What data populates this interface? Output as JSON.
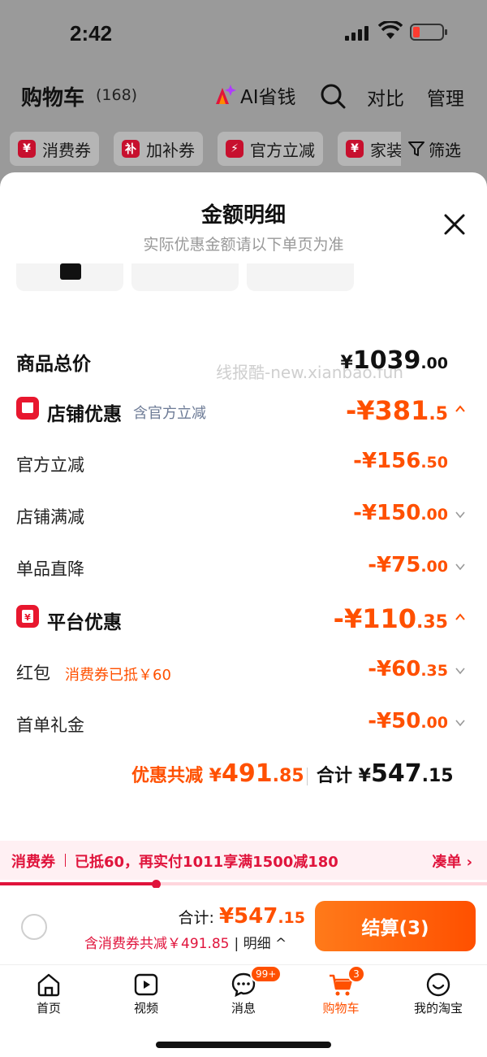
{
  "status": {
    "time": "2:42"
  },
  "header": {
    "title": "购物车",
    "count": "(168)",
    "ai_label": "AI省钱",
    "compare": "对比",
    "manage": "管理"
  },
  "chips": [
    {
      "icon": "¥",
      "label": "消费券"
    },
    {
      "icon": "补",
      "label": "加补券"
    },
    {
      "icon": "⚡",
      "label": "官方立减"
    },
    {
      "icon": "¥",
      "label": "家装"
    }
  ],
  "filter": "筛选",
  "sheet": {
    "title": "金额明细",
    "subtitle": "实际优惠金额请以下单页为准"
  },
  "watermark": "线报酷-new.xianbao.fun",
  "rows": {
    "total": {
      "label": "商品总价",
      "yen": "¥",
      "int": "1039",
      "dec": ".00"
    },
    "shop": {
      "label": "店铺优惠",
      "note": "含官方立减",
      "int": "-¥381",
      "dec": ".5"
    },
    "official": {
      "label": "官方立减",
      "int": "-¥156",
      "dec": ".50"
    },
    "shop_full": {
      "label": "店铺满减",
      "int": "-¥150",
      "dec": ".00"
    },
    "direct": {
      "label": "单品直降",
      "int": "-¥75",
      "dec": ".00"
    },
    "platform": {
      "label": "平台优惠",
      "int": "-¥110",
      "dec": ".35"
    },
    "redpack": {
      "label": "红包",
      "note": "消费券已抵￥60",
      "int": "-¥60",
      "dec": ".35"
    },
    "gift": {
      "label": "首单礼金",
      "int": "-¥50",
      "dec": ".00"
    }
  },
  "summary": {
    "discount_label": "优惠共减 ¥",
    "discount_int": "491",
    "discount_dec": ".85",
    "total_label": "合计 ¥",
    "total_int": "547",
    "total_dec": ".15"
  },
  "banner": {
    "tag": "消费券",
    "text": "已抵60，再实付1011享满1500减180",
    "go": "凑单 ›",
    "progress": 0.32
  },
  "checkout": {
    "total_label": "合计: ",
    "total_int": "¥547",
    "total_dec": ".15",
    "sub": "含消费券共减￥491.85",
    "detail": "| 明细 ^",
    "pay": "结算(3)"
  },
  "tabs": [
    {
      "label": "首页",
      "icon": "home-icon"
    },
    {
      "label": "视频",
      "icon": "video-icon"
    },
    {
      "label": "消息",
      "icon": "message-icon",
      "badge": "99+"
    },
    {
      "label": "购物车",
      "icon": "cart-icon",
      "badge": "3",
      "active": true
    },
    {
      "label": "我的淘宝",
      "icon": "profile-icon"
    }
  ],
  "colors": {
    "accent": "#ff5000",
    "coupon_red": "#e0143c",
    "note_gray": "#6d7b96"
  }
}
